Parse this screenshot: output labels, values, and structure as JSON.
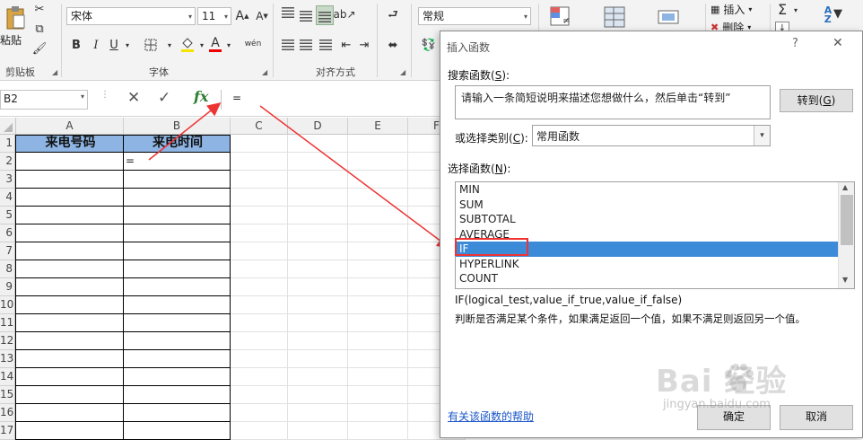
{
  "ribbon": {
    "clipboard": {
      "paste_label": "粘贴",
      "group_label": "剪贴板"
    },
    "font": {
      "name": "宋体",
      "size": "11",
      "grow_glyph": "A",
      "shrink_glyph": "A",
      "bold": "B",
      "italic": "I",
      "underline": "U",
      "color_glyph": "A",
      "phonetic_glyph": "wén",
      "group_label": "字体"
    },
    "alignment": {
      "group_label": "对齐方式"
    },
    "number": {
      "format": "常规"
    },
    "cells": {
      "insert_label": "插入",
      "delete_label": "删除"
    }
  },
  "formula_bar": {
    "name_box": "B2",
    "cancel_glyph": "✕",
    "enter_glyph": "✓",
    "fx_label": "fx",
    "content": "="
  },
  "sheet": {
    "columns": [
      "A",
      "B",
      "C",
      "D",
      "E",
      "F"
    ],
    "rows": [
      "1",
      "2",
      "3",
      "4",
      "5",
      "6",
      "7",
      "8",
      "9",
      "10",
      "11",
      "12",
      "13",
      "14",
      "15",
      "16",
      "17"
    ],
    "a1": "来电号码",
    "b1": "来电时间",
    "b2": "="
  },
  "dialog": {
    "title": "插入函数",
    "help_glyph": "?",
    "close_glyph": "✕",
    "search_label": "搜索函数(",
    "search_key": "S",
    "search_suffix": "):",
    "search_text": "请输入一条简短说明来描述您想做什么，然后单击“转到”",
    "goto_label": "转到(",
    "goto_key": "G",
    "goto_suffix": ")",
    "category_label": "或选择类别(",
    "category_key": "C",
    "category_suffix": "):",
    "category_value": "常用函数",
    "select_label": "选择函数(",
    "select_key": "N",
    "select_suffix": "):",
    "functions": [
      "MIN",
      "SUM",
      "SUBTOTAL",
      "AVERAGE",
      "IF",
      "HYPERLINK",
      "COUNT"
    ],
    "selected_function": "IF",
    "signature": "IF(logical_test,value_if_true,value_if_false)",
    "description": "判断是否满足某个条件，如果满足返回一个值，如果不满足则返回另一个值。",
    "help_link": "有关该函数的帮助",
    "ok_label": "确定",
    "cancel_label": "取消"
  },
  "watermark": {
    "brand": "Bai  经验",
    "url": "jingyan.baidu.com"
  },
  "colors": {
    "header_fill": "#8db4e2",
    "selection": "#3c8bd9",
    "annotation": "#ee3333"
  }
}
